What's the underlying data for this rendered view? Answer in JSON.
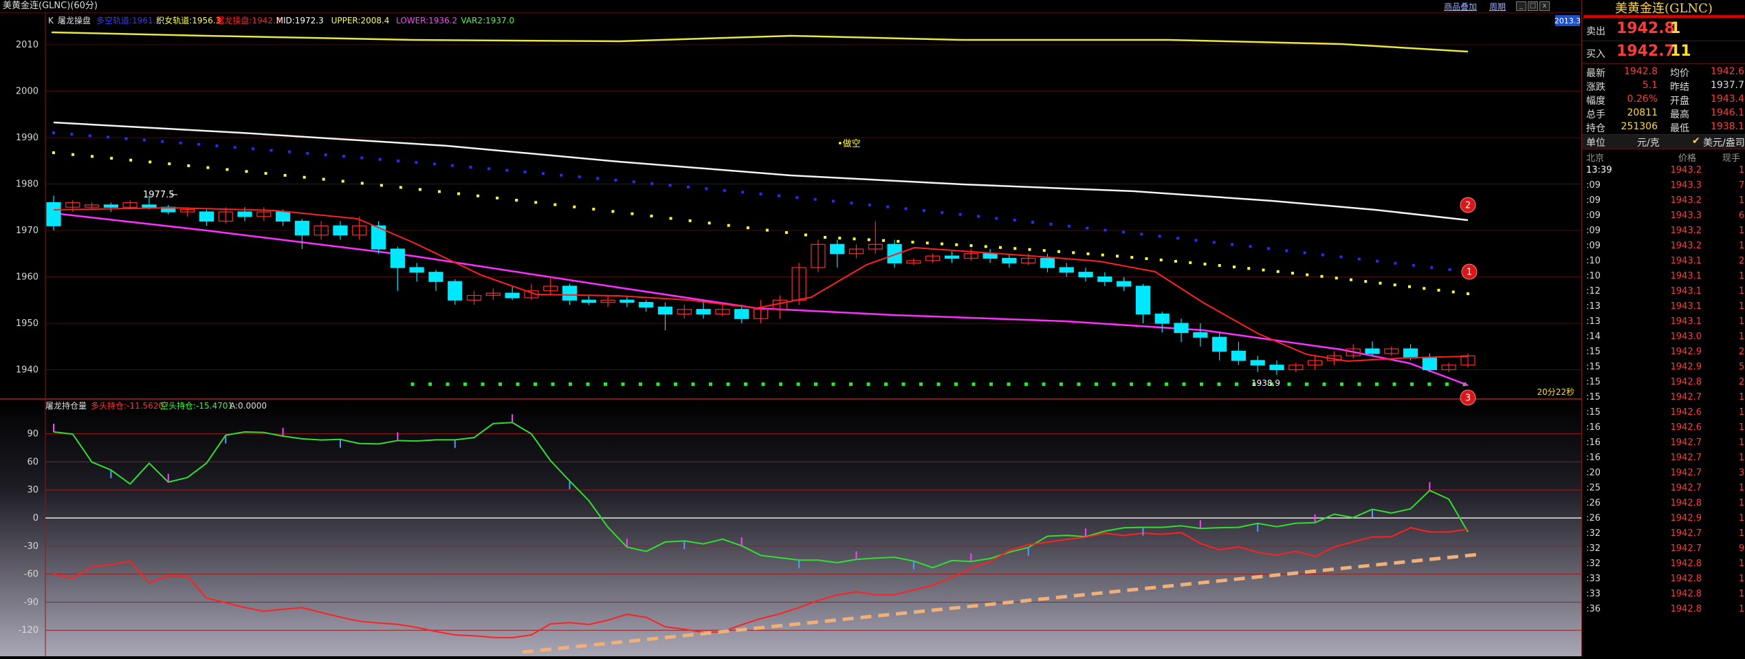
{
  "window": {
    "title": "美黄金连(GLNC)(60分)",
    "links": [
      "商品叠加",
      "周期"
    ],
    "buttons": [
      "_",
      "□",
      "x"
    ]
  },
  "main_chart": {
    "indicator_line": {
      "prefix": "K",
      "name": "屠龙操盘",
      "items": [
        {
          "text": "多空轨道:1961.2",
          "color": "#3a3aff"
        },
        {
          "text": "织女轨道:1956.3",
          "color": "#ffff40"
        },
        {
          "text": "屠龙操盘:1942.3",
          "color": "#ff2020"
        },
        {
          "text": "MID:1972.3",
          "color": "#ffffff"
        },
        {
          "text": "UPPER:2008.4",
          "color": "#ffff40"
        },
        {
          "text": "LOWER:1936.2",
          "color": "#ff40ff"
        },
        {
          "text": "VAR2:1937.0",
          "color": "#40ff40"
        }
      ]
    },
    "y_labels": [
      "2010",
      "2000",
      "1990",
      "1980",
      "1970",
      "1960",
      "1950",
      "1940"
    ],
    "annotations": {
      "high": "1977.5",
      "low": "1938.9",
      "signal": "做空",
      "countdown": "20分22秒"
    },
    "markers": [
      "2",
      "1",
      "3"
    ],
    "price_tag": "2013.3"
  },
  "sub_chart": {
    "name": "屠龙持仓量",
    "items": [
      {
        "text": "多头持仓:-11.5620",
        "color": "#ff3030"
      },
      {
        "text": "空头持仓:-15.4701",
        "color": "#30ff30"
      },
      {
        "text": "A:0.0000",
        "color": "#dddddd"
      }
    ],
    "y_labels": [
      "90",
      "60",
      "30",
      "0",
      "-30",
      "-60",
      "-90",
      "-120"
    ]
  },
  "quote_panel": {
    "title": "美黄金连(GLNC)",
    "sell": {
      "label": "卖出",
      "price": "1942.8",
      "volume": "1"
    },
    "buy": {
      "label": "买入",
      "price": "1942.7",
      "volume": "11"
    },
    "stats": [
      {
        "l1": "最新",
        "v1": "1942.8",
        "c1": "#ff3a3a",
        "l2": "均价",
        "v2": "1942.6",
        "c2": "#ff3a3a"
      },
      {
        "l1": "涨跌",
        "v1": "5.1",
        "c1": "#ff3a3a",
        "l2": "昨结",
        "v2": "1937.7",
        "c2": "#dddddd"
      },
      {
        "l1": "幅度",
        "v1": "0.26%",
        "c1": "#ff3a3a",
        "l2": "开盘",
        "v2": "1943.4",
        "c2": "#ff3a3a"
      },
      {
        "l1": "总手",
        "v1": "20811",
        "c1": "#ffdf2a",
        "l2": "最高",
        "v2": "1946.1",
        "c2": "#ff3a3a"
      },
      {
        "l1": "持仓",
        "v1": "251306",
        "c1": "#ffdf2a",
        "l2": "最低",
        "v2": "1938.1",
        "c2": "#ff3a3a"
      }
    ],
    "unit": {
      "label": "单位",
      "value": "元/克",
      "check": "✔",
      "currency": "美元/盎司"
    },
    "tick_header": {
      "time": "北京",
      "price": "价格",
      "vol": "现手"
    },
    "ticks": [
      {
        "t": "13:39",
        "p": "1943.2",
        "c": "#ff3a3a",
        "v": "1"
      },
      {
        "t": ":09",
        "p": "1943.3",
        "c": "#ff3a3a",
        "v": "7"
      },
      {
        "t": ":09",
        "p": "1943.2",
        "c": "#ff3a3a",
        "v": "1"
      },
      {
        "t": ":09",
        "p": "1943.3",
        "c": "#ff3a3a",
        "v": "6"
      },
      {
        "t": ":09",
        "p": "1943.2",
        "c": "#ff3a3a",
        "v": "1"
      },
      {
        "t": ":09",
        "p": "1943.2",
        "c": "#ff3a3a",
        "v": "1"
      },
      {
        "t": ":10",
        "p": "1943.1",
        "c": "#ff3a3a",
        "v": "2"
      },
      {
        "t": ":10",
        "p": "1943.1",
        "c": "#ff3a3a",
        "v": "1"
      },
      {
        "t": ":12",
        "p": "1943.1",
        "c": "#ff3a3a",
        "v": "1"
      },
      {
        "t": ":13",
        "p": "1943.1",
        "c": "#ff3a3a",
        "v": "1"
      },
      {
        "t": ":13",
        "p": "1943.1",
        "c": "#ff3a3a",
        "v": "1"
      },
      {
        "t": ":14",
        "p": "1943.0",
        "c": "#ff3a3a",
        "v": "1"
      },
      {
        "t": ":15",
        "p": "1942.9",
        "c": "#ff3a3a",
        "v": "2"
      },
      {
        "t": ":15",
        "p": "1942.9",
        "c": "#ff3a3a",
        "v": "5"
      },
      {
        "t": ":15",
        "p": "1942.8",
        "c": "#ff3a3a",
        "v": "2"
      },
      {
        "t": ":15",
        "p": "1942.7",
        "c": "#ff3a3a",
        "v": "1"
      },
      {
        "t": ":15",
        "p": "1942.6",
        "c": "#ff3a3a",
        "v": "1"
      },
      {
        "t": ":16",
        "p": "1942.6",
        "c": "#ff3a3a",
        "v": "1"
      },
      {
        "t": ":16",
        "p": "1942.7",
        "c": "#ff3a3a",
        "v": "1"
      },
      {
        "t": ":16",
        "p": "1942.7",
        "c": "#ff3a3a",
        "v": "1"
      },
      {
        "t": ":20",
        "p": "1942.7",
        "c": "#ff3a3a",
        "v": "3"
      },
      {
        "t": ":25",
        "p": "1942.7",
        "c": "#ff3a3a",
        "v": "1"
      },
      {
        "t": ":26",
        "p": "1942.8",
        "c": "#ff3a3a",
        "v": "1"
      },
      {
        "t": ":26",
        "p": "1942.9",
        "c": "#ff3a3a",
        "v": "1"
      },
      {
        "t": ":32",
        "p": "1942.7",
        "c": "#ff3a3a",
        "v": "1"
      },
      {
        "t": ":32",
        "p": "1942.7",
        "c": "#ff3a3a",
        "v": "9"
      },
      {
        "t": ":32",
        "p": "1942.8",
        "c": "#ff3a3a",
        "v": "1"
      },
      {
        "t": ":33",
        "p": "1942.8",
        "c": "#ff3a3a",
        "v": "1"
      },
      {
        "t": ":33",
        "p": "1942.8",
        "c": "#ff3a3a",
        "v": "1"
      },
      {
        "t": ":36",
        "p": "1942.8",
        "c": "#ff3a3a",
        "v": "1"
      }
    ]
  }
}
